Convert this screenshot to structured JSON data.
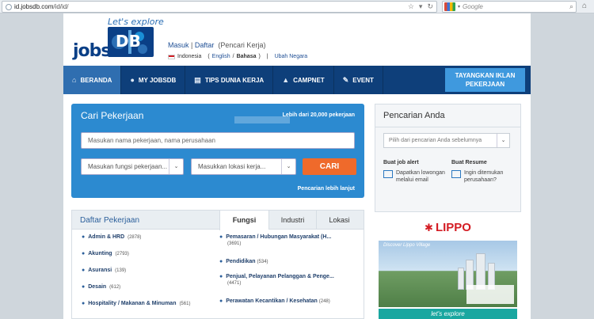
{
  "browser": {
    "url_host": "id.jobsdb.com",
    "url_path": "/id/id/",
    "search_placeholder": "Google"
  },
  "header": {
    "logo_tagline": "Let's explore",
    "logo_text": "jobs",
    "logo_db": "DB",
    "login": "Masuk",
    "separator": "|",
    "register": "Daftar",
    "role": "(Pencari Kerja)",
    "country": "Indonesia",
    "lang_open": "(",
    "lang_en": "English",
    "lang_sep": "/",
    "lang_id": "Bahasa",
    "lang_close": ")",
    "lang_sep2": "|",
    "change_country": "Ubah Negara"
  },
  "nav": {
    "items": [
      {
        "label": "BERANDA",
        "icon": "home-icon"
      },
      {
        "label": "MY JOBSDB",
        "icon": "user-icon"
      },
      {
        "label": "TIPS DUNIA KERJA",
        "icon": "book-icon"
      },
      {
        "label": "CAMPNET",
        "icon": "graduation-cap-icon"
      },
      {
        "label": "EVENT",
        "icon": "pencil-icon"
      }
    ],
    "ads_button_line1": "TAYANGKAN IKLAN",
    "ads_button_line2": "PEKERJAAN"
  },
  "search": {
    "title": "Cari Pekerjaan",
    "job_count": "Lebih dari 20,000 pekerjaan",
    "keyword_placeholder": "Masukan nama pekerjaan, nama perusahaan",
    "function_placeholder": "Masukan fungsi pekerjaan...",
    "location_placeholder": "Masukkan lokasi kerja...",
    "submit": "CARI",
    "advanced": "Pencarian lebih lanjut"
  },
  "listing": {
    "title": "Daftar Pekerjaan",
    "tabs": [
      "Fungsi",
      "Industri",
      "Lokasi"
    ],
    "left_items": [
      {
        "label": "Admin & HRD",
        "count": "(2878)"
      },
      {
        "label": "Akunting",
        "count": "(2793)"
      },
      {
        "label": "Asuransi",
        "count": "(139)"
      },
      {
        "label": "Desain",
        "count": "(612)"
      },
      {
        "label": "Hospitality / Makanan & Minuman",
        "count": "(561)"
      }
    ],
    "right_items": [
      {
        "label": "Pemasaran / Hubungan Masyarakat (H...",
        "count": "(3691)"
      },
      {
        "label": "Pendidikan",
        "count": "(534)"
      },
      {
        "label": "Penjual, Pelayanan Pelanggan & Penge...",
        "count": "(4471)"
      },
      {
        "label": "Perawatan Kecantikan / Kesehatan",
        "count": "(248)"
      }
    ]
  },
  "sidebar": {
    "title": "Pencarian Anda",
    "select_placeholder": "Pilih dari pencarian Anda sebelumnya",
    "alert_title": "Buat job alert",
    "alert_text": "Dapatkan lowongan melalui email",
    "resume_title": "Buat Resume",
    "resume_text": "Ingin ditemukan perusahaan?"
  },
  "ad": {
    "brand": "LIPPO",
    "headline": "Discover Lippo Village",
    "footer": "let's explore"
  },
  "colors": {
    "nav_bg": "#0e3f7a",
    "nav_active": "#2f6eb0",
    "search_bg": "#2c8ad0",
    "cta": "#ef6a2b",
    "brand_red": "#d41d24"
  }
}
